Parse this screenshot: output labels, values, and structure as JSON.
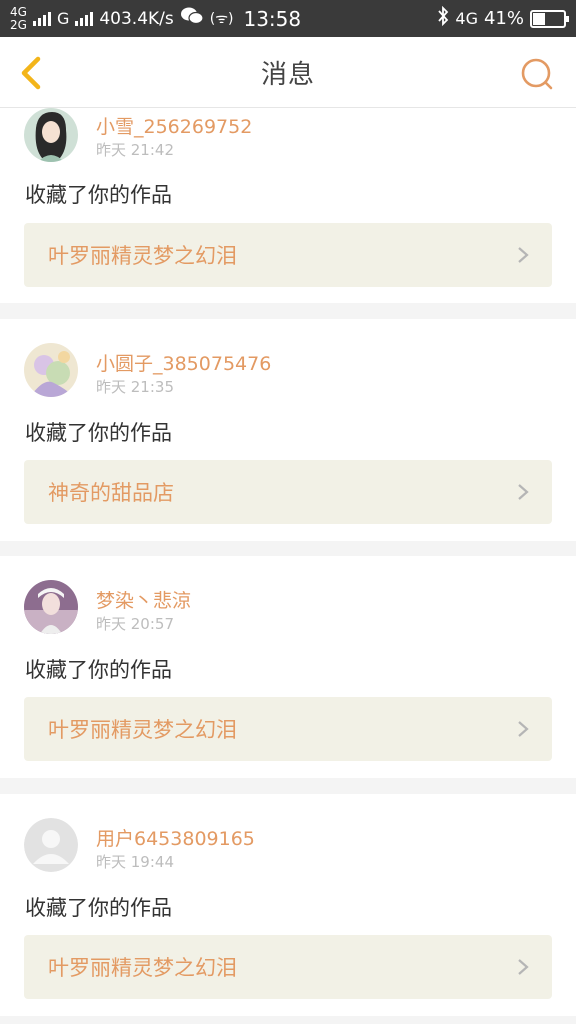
{
  "status_bar": {
    "net_top": "4G",
    "net_bottom": "2G",
    "carrier": "G",
    "speed": "403.4K/s",
    "time": "13:58",
    "net_right": "4G",
    "battery_text": "41%",
    "battery_level": 0.41
  },
  "header": {
    "title": "消息"
  },
  "colors": {
    "accent": "#e39a63",
    "back_arrow": "#f3b51a",
    "card_link_bg": "#f2f1e6"
  },
  "messages": [
    {
      "username": "小雪_256269752",
      "time": "昨天 21:42",
      "action": "收藏了你的作品",
      "work": "叶罗丽精灵梦之幻泪"
    },
    {
      "username": "小圆子_385075476",
      "time": "昨天 21:35",
      "action": "收藏了你的作品",
      "work": "神奇的甜品店"
    },
    {
      "username": "梦染丶悲涼",
      "time": "昨天 20:57",
      "action": "收藏了你的作品",
      "work": "叶罗丽精灵梦之幻泪"
    },
    {
      "username": "用户6453809165",
      "time": "昨天 19:44",
      "action": "收藏了你的作品",
      "work": "叶罗丽精灵梦之幻泪"
    }
  ]
}
